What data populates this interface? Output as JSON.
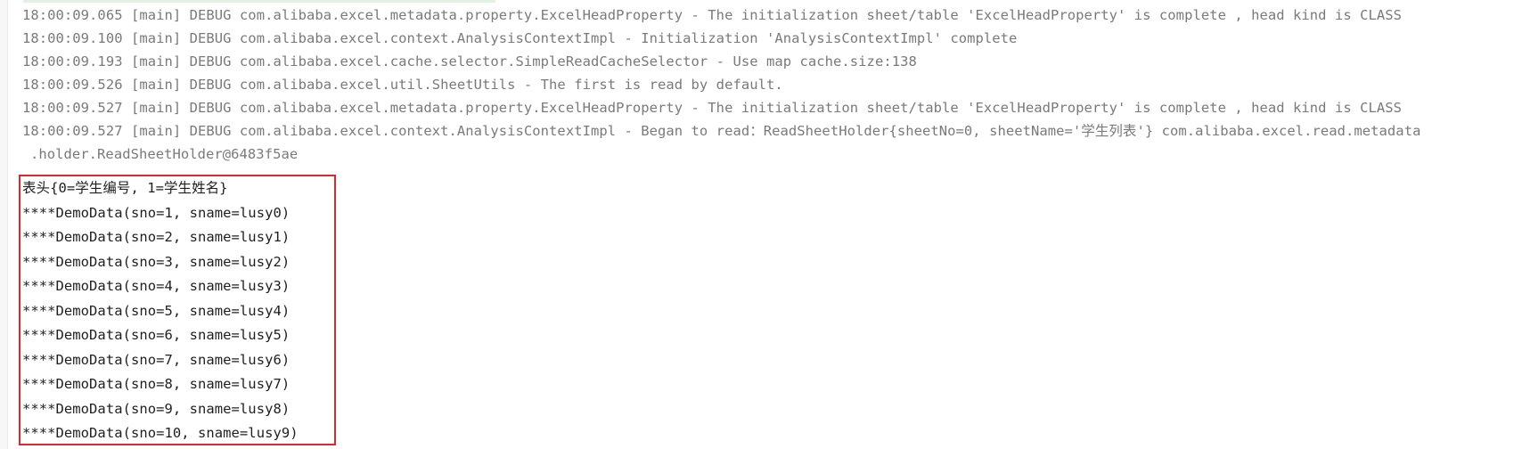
{
  "log_lines": [
    "18:00:09.065 [main] DEBUG com.alibaba.excel.metadata.property.ExcelHeadProperty - The initialization sheet/table 'ExcelHeadProperty' is complete , head kind is CLASS",
    "18:00:09.100 [main] DEBUG com.alibaba.excel.context.AnalysisContextImpl - Initialization 'AnalysisContextImpl' complete",
    "18:00:09.193 [main] DEBUG com.alibaba.excel.cache.selector.SimpleReadCacheSelector - Use map cache.size:138",
    "18:00:09.526 [main] DEBUG com.alibaba.excel.util.SheetUtils - The first is read by default.",
    "18:00:09.527 [main] DEBUG com.alibaba.excel.metadata.property.ExcelHeadProperty - The initialization sheet/table 'ExcelHeadProperty' is complete , head kind is CLASS",
    "18:00:09.527 [main] DEBUG com.alibaba.excel.context.AnalysisContextImpl - Began to read：ReadSheetHolder{sheetNo=0, sheetName='学生列表'} com.alibaba.excel.read.metadata"
  ],
  "log_wrap_line": ".holder.ReadSheetHolder@6483f5ae",
  "output_lines": [
    "表头{0=学生编号, 1=学生姓名}",
    "****DemoData(sno=1, sname=lusy0)",
    "****DemoData(sno=2, sname=lusy1)",
    "****DemoData(sno=3, sname=lusy2)",
    "****DemoData(sno=4, sname=lusy3)",
    "****DemoData(sno=5, sname=lusy4)",
    "****DemoData(sno=6, sname=lusy5)",
    "****DemoData(sno=7, sname=lusy6)",
    "****DemoData(sno=8, sname=lusy7)",
    "****DemoData(sno=9, sname=lusy8)",
    "****DemoData(sno=10, sname=lusy9)"
  ],
  "colors": {
    "log_text": "#7a7a7a",
    "output_text": "#1f1f1f",
    "highlight_border": "#e0262d",
    "background": "#ffffff"
  }
}
